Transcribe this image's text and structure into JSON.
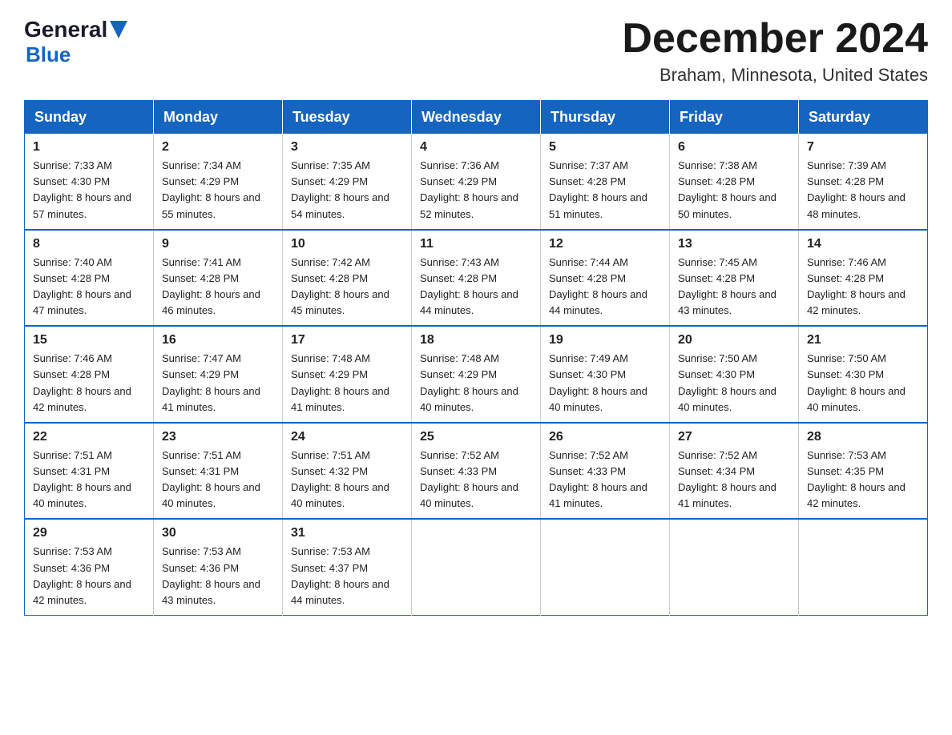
{
  "logo": {
    "text_general": "General",
    "arrow": "▶",
    "text_blue": "Blue"
  },
  "header": {
    "title": "December 2024",
    "subtitle": "Braham, Minnesota, United States"
  },
  "days_of_week": [
    "Sunday",
    "Monday",
    "Tuesday",
    "Wednesday",
    "Thursday",
    "Friday",
    "Saturday"
  ],
  "weeks": [
    [
      {
        "day": "1",
        "sunrise": "7:33 AM",
        "sunset": "4:30 PM",
        "daylight": "8 hours and 57 minutes."
      },
      {
        "day": "2",
        "sunrise": "7:34 AM",
        "sunset": "4:29 PM",
        "daylight": "8 hours and 55 minutes."
      },
      {
        "day": "3",
        "sunrise": "7:35 AM",
        "sunset": "4:29 PM",
        "daylight": "8 hours and 54 minutes."
      },
      {
        "day": "4",
        "sunrise": "7:36 AM",
        "sunset": "4:29 PM",
        "daylight": "8 hours and 52 minutes."
      },
      {
        "day": "5",
        "sunrise": "7:37 AM",
        "sunset": "4:28 PM",
        "daylight": "8 hours and 51 minutes."
      },
      {
        "day": "6",
        "sunrise": "7:38 AM",
        "sunset": "4:28 PM",
        "daylight": "8 hours and 50 minutes."
      },
      {
        "day": "7",
        "sunrise": "7:39 AM",
        "sunset": "4:28 PM",
        "daylight": "8 hours and 48 minutes."
      }
    ],
    [
      {
        "day": "8",
        "sunrise": "7:40 AM",
        "sunset": "4:28 PM",
        "daylight": "8 hours and 47 minutes."
      },
      {
        "day": "9",
        "sunrise": "7:41 AM",
        "sunset": "4:28 PM",
        "daylight": "8 hours and 46 minutes."
      },
      {
        "day": "10",
        "sunrise": "7:42 AM",
        "sunset": "4:28 PM",
        "daylight": "8 hours and 45 minutes."
      },
      {
        "day": "11",
        "sunrise": "7:43 AM",
        "sunset": "4:28 PM",
        "daylight": "8 hours and 44 minutes."
      },
      {
        "day": "12",
        "sunrise": "7:44 AM",
        "sunset": "4:28 PM",
        "daylight": "8 hours and 44 minutes."
      },
      {
        "day": "13",
        "sunrise": "7:45 AM",
        "sunset": "4:28 PM",
        "daylight": "8 hours and 43 minutes."
      },
      {
        "day": "14",
        "sunrise": "7:46 AM",
        "sunset": "4:28 PM",
        "daylight": "8 hours and 42 minutes."
      }
    ],
    [
      {
        "day": "15",
        "sunrise": "7:46 AM",
        "sunset": "4:28 PM",
        "daylight": "8 hours and 42 minutes."
      },
      {
        "day": "16",
        "sunrise": "7:47 AM",
        "sunset": "4:29 PM",
        "daylight": "8 hours and 41 minutes."
      },
      {
        "day": "17",
        "sunrise": "7:48 AM",
        "sunset": "4:29 PM",
        "daylight": "8 hours and 41 minutes."
      },
      {
        "day": "18",
        "sunrise": "7:48 AM",
        "sunset": "4:29 PM",
        "daylight": "8 hours and 40 minutes."
      },
      {
        "day": "19",
        "sunrise": "7:49 AM",
        "sunset": "4:30 PM",
        "daylight": "8 hours and 40 minutes."
      },
      {
        "day": "20",
        "sunrise": "7:50 AM",
        "sunset": "4:30 PM",
        "daylight": "8 hours and 40 minutes."
      },
      {
        "day": "21",
        "sunrise": "7:50 AM",
        "sunset": "4:30 PM",
        "daylight": "8 hours and 40 minutes."
      }
    ],
    [
      {
        "day": "22",
        "sunrise": "7:51 AM",
        "sunset": "4:31 PM",
        "daylight": "8 hours and 40 minutes."
      },
      {
        "day": "23",
        "sunrise": "7:51 AM",
        "sunset": "4:31 PM",
        "daylight": "8 hours and 40 minutes."
      },
      {
        "day": "24",
        "sunrise": "7:51 AM",
        "sunset": "4:32 PM",
        "daylight": "8 hours and 40 minutes."
      },
      {
        "day": "25",
        "sunrise": "7:52 AM",
        "sunset": "4:33 PM",
        "daylight": "8 hours and 40 minutes."
      },
      {
        "day": "26",
        "sunrise": "7:52 AM",
        "sunset": "4:33 PM",
        "daylight": "8 hours and 41 minutes."
      },
      {
        "day": "27",
        "sunrise": "7:52 AM",
        "sunset": "4:34 PM",
        "daylight": "8 hours and 41 minutes."
      },
      {
        "day": "28",
        "sunrise": "7:53 AM",
        "sunset": "4:35 PM",
        "daylight": "8 hours and 42 minutes."
      }
    ],
    [
      {
        "day": "29",
        "sunrise": "7:53 AM",
        "sunset": "4:36 PM",
        "daylight": "8 hours and 42 minutes."
      },
      {
        "day": "30",
        "sunrise": "7:53 AM",
        "sunset": "4:36 PM",
        "daylight": "8 hours and 43 minutes."
      },
      {
        "day": "31",
        "sunrise": "7:53 AM",
        "sunset": "4:37 PM",
        "daylight": "8 hours and 44 minutes."
      },
      null,
      null,
      null,
      null
    ]
  ]
}
